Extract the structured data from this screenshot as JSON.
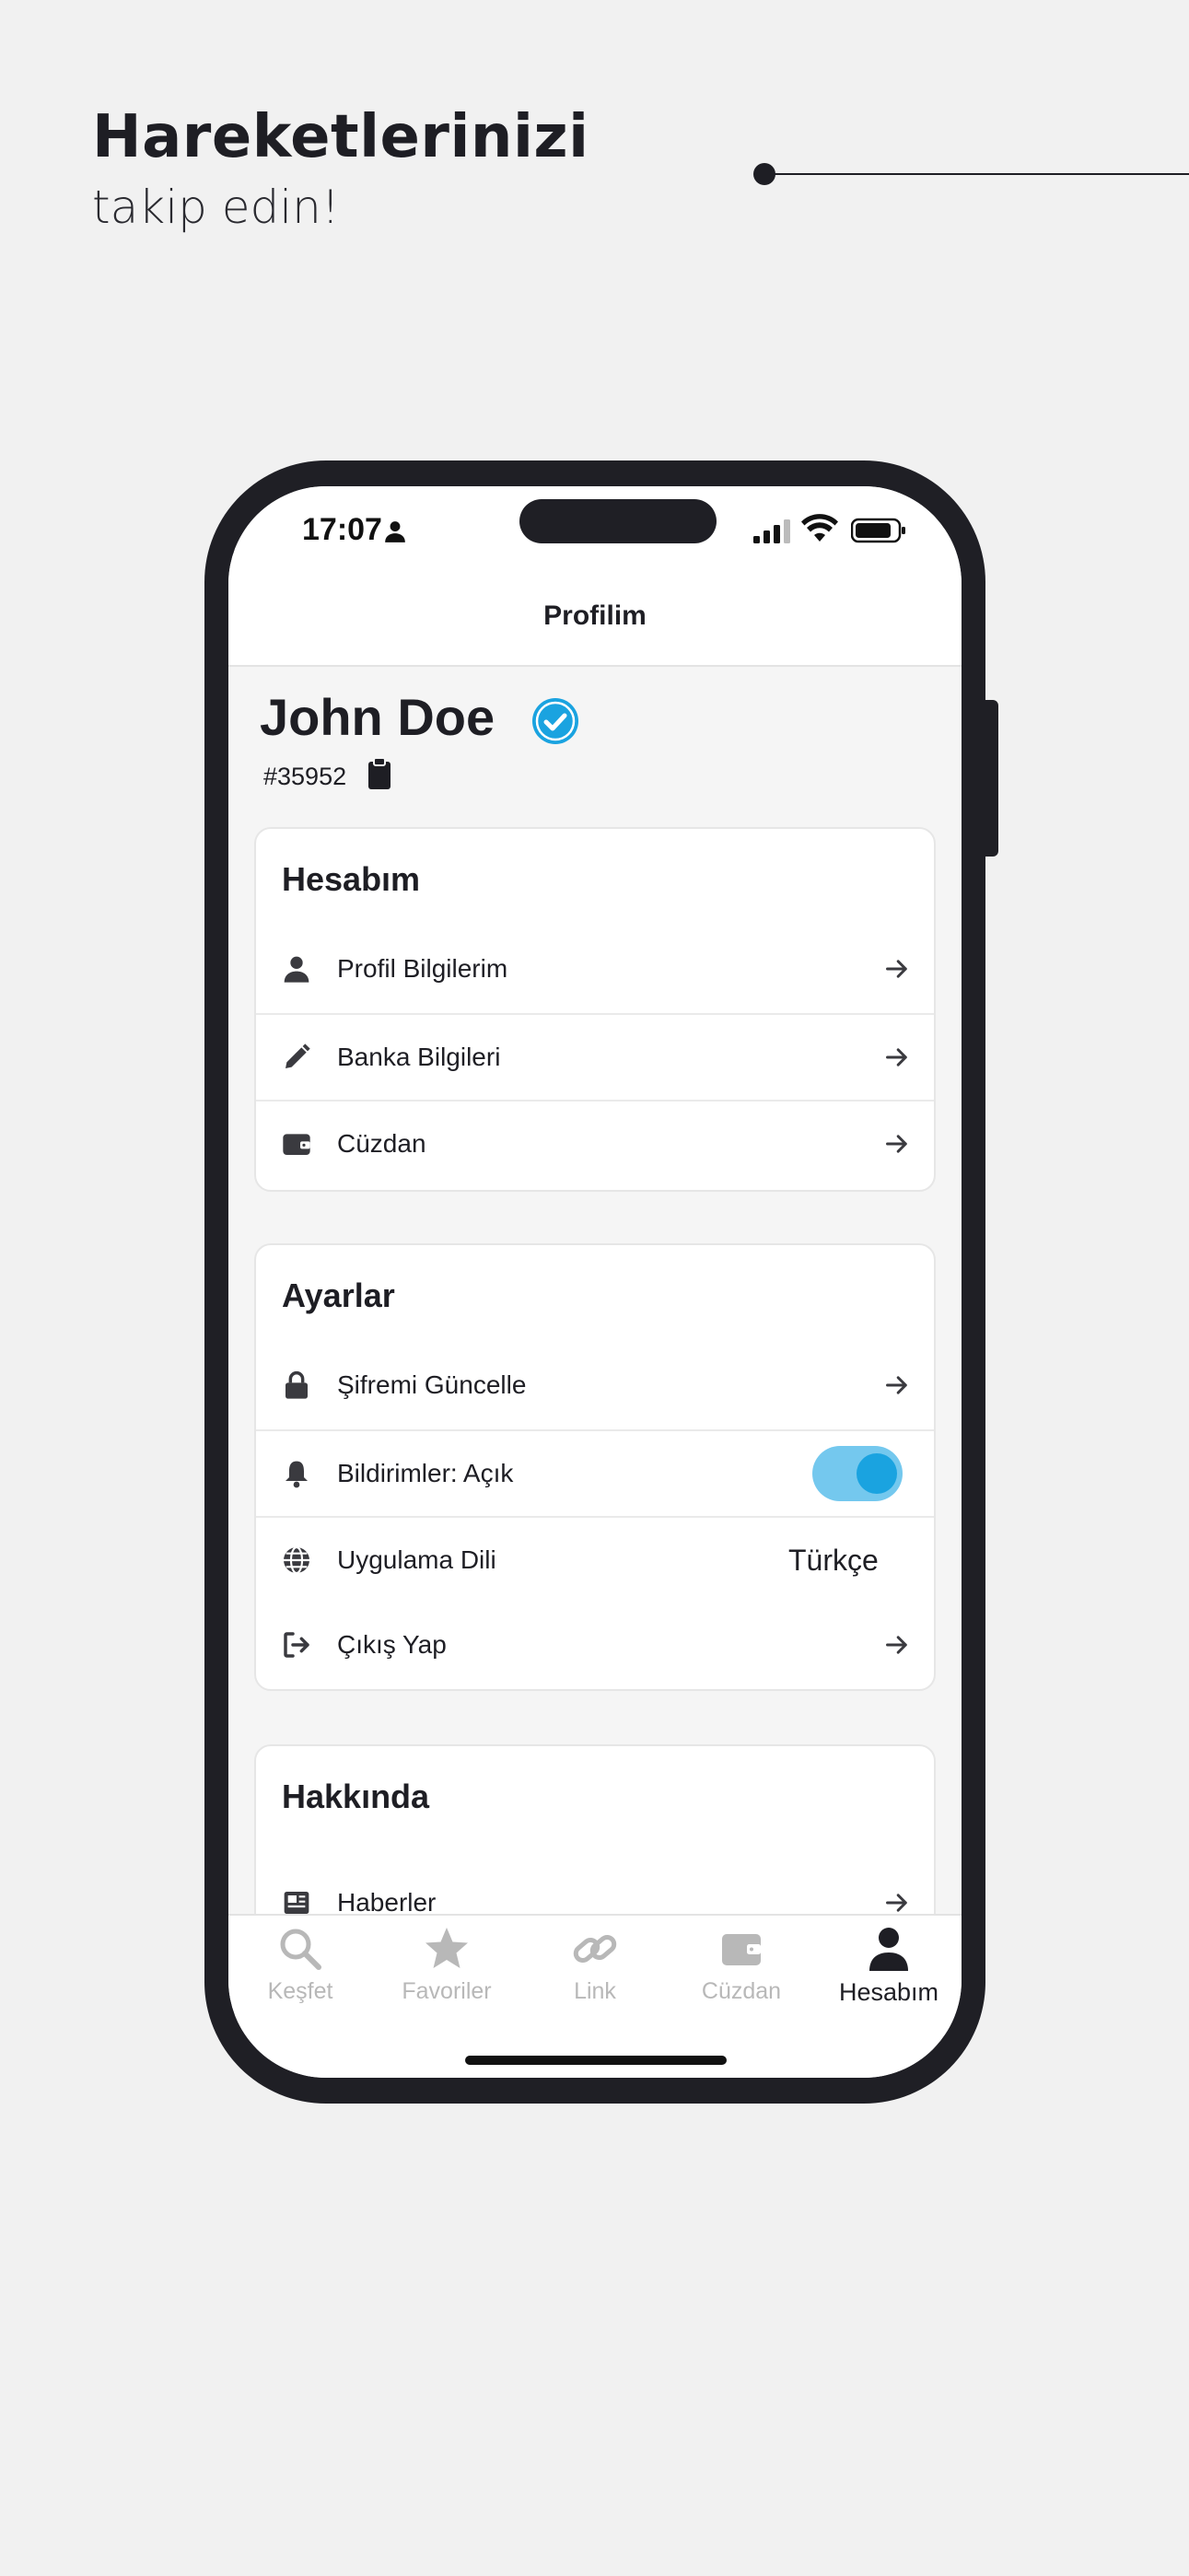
{
  "promo": {
    "title": "Hareketlerinizi",
    "subtitle": "takip edin!"
  },
  "status_bar": {
    "time": "17:07"
  },
  "nav": {
    "title": "Profilim"
  },
  "profile": {
    "name": "John Doe",
    "id": "#35952",
    "verified": true
  },
  "sections": [
    {
      "title": "Hesabım",
      "items": [
        {
          "label": "Profil Bilgilerim",
          "icon": "person-icon"
        },
        {
          "label": "Banka Bilgileri",
          "icon": "pencil-icon"
        },
        {
          "label": "Cüzdan",
          "icon": "wallet-icon"
        }
      ]
    },
    {
      "title": "Ayarlar",
      "items": [
        {
          "label": "Şifremi Güncelle",
          "icon": "lock-icon"
        },
        {
          "label": "Bildirimler: Açık",
          "icon": "bell-icon",
          "toggle_on": true
        },
        {
          "label": "Uygulama Dili",
          "icon": "globe-icon",
          "value": "Türkçe"
        },
        {
          "label": "Çıkış Yap",
          "icon": "logout-icon"
        }
      ]
    },
    {
      "title": "Hakkında",
      "items": [
        {
          "label": "Haberler",
          "icon": "news-icon"
        }
      ]
    }
  ],
  "tabs": [
    {
      "label": "Keşfet",
      "icon": "search-icon",
      "active": false
    },
    {
      "label": "Favoriler",
      "icon": "star-icon",
      "active": false
    },
    {
      "label": "Link",
      "icon": "link-icon",
      "active": false
    },
    {
      "label": "Cüzdan",
      "icon": "wallet-icon",
      "active": false
    },
    {
      "label": "Hesabım",
      "icon": "person-icon",
      "active": true
    }
  ],
  "colors": {
    "accent": "#1aa3e0",
    "toggle_track": "#74c8ee",
    "frame": "#1f1f25",
    "inactive_tab": "#b8b8b8"
  }
}
